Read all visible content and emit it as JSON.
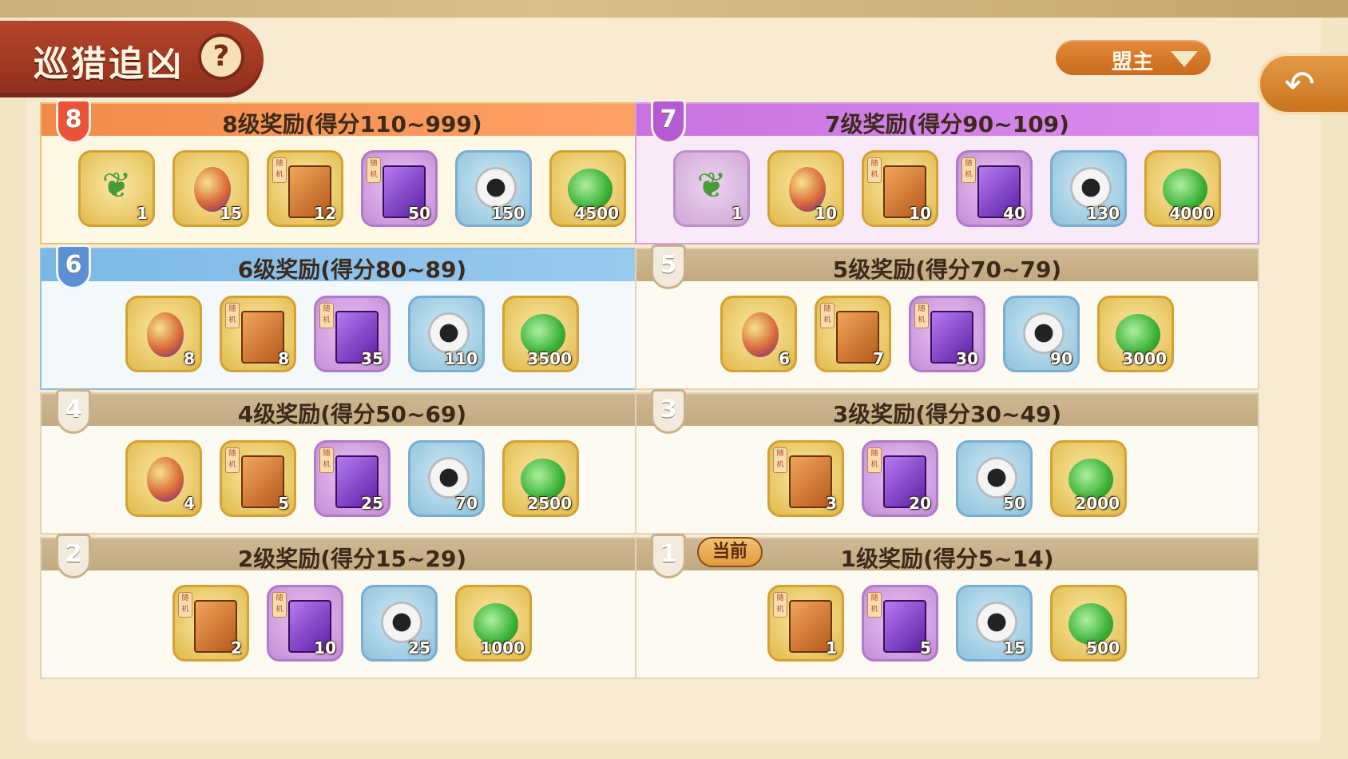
{
  "header": {
    "title": "巡猎追凶",
    "role_dropdown": "盟主"
  },
  "current_label": "当前",
  "panels": [
    {
      "tier": "8",
      "title": "8级奖励(得分110~999)",
      "items": [
        {
          "icon": "herb-icon",
          "qty": "1"
        },
        {
          "icon": "egg-icon",
          "qty": "15"
        },
        {
          "icon": "orange-box-icon",
          "qty": "12",
          "tag": "随机"
        },
        {
          "icon": "purple-box-icon",
          "qty": "50",
          "tag": "随机"
        },
        {
          "icon": "disc-icon",
          "qty": "150"
        },
        {
          "icon": "jade-icon",
          "qty": "4500"
        }
      ]
    },
    {
      "tier": "7",
      "title": "7级奖励(得分90~109)",
      "items": [
        {
          "icon": "herb-icon",
          "qty": "1"
        },
        {
          "icon": "egg-icon",
          "qty": "10"
        },
        {
          "icon": "orange-box-icon",
          "qty": "10",
          "tag": "随机"
        },
        {
          "icon": "purple-box-icon",
          "qty": "40",
          "tag": "随机"
        },
        {
          "icon": "disc-icon",
          "qty": "130"
        },
        {
          "icon": "jade-icon",
          "qty": "4000"
        }
      ]
    },
    {
      "tier": "6",
      "title": "6级奖励(得分80~89)",
      "items": [
        {
          "icon": "egg-icon",
          "qty": "8"
        },
        {
          "icon": "orange-box-icon",
          "qty": "8",
          "tag": "随机"
        },
        {
          "icon": "purple-box-icon",
          "qty": "35",
          "tag": "随机"
        },
        {
          "icon": "disc-icon",
          "qty": "110"
        },
        {
          "icon": "jade-icon",
          "qty": "3500"
        }
      ]
    },
    {
      "tier": "5",
      "title": "5级奖励(得分70~79)",
      "items": [
        {
          "icon": "egg-icon",
          "qty": "6"
        },
        {
          "icon": "orange-box-icon",
          "qty": "7",
          "tag": "随机"
        },
        {
          "icon": "purple-box-icon",
          "qty": "30",
          "tag": "随机"
        },
        {
          "icon": "disc-icon",
          "qty": "90"
        },
        {
          "icon": "jade-icon",
          "qty": "3000"
        }
      ]
    },
    {
      "tier": "4",
      "title": "4级奖励(得分50~69)",
      "items": [
        {
          "icon": "egg-icon",
          "qty": "4"
        },
        {
          "icon": "orange-box-icon",
          "qty": "5",
          "tag": "随机"
        },
        {
          "icon": "purple-box-icon",
          "qty": "25",
          "tag": "随机"
        },
        {
          "icon": "disc-icon",
          "qty": "70"
        },
        {
          "icon": "jade-icon",
          "qty": "2500"
        }
      ]
    },
    {
      "tier": "3",
      "title": "3级奖励(得分30~49)",
      "items": [
        {
          "icon": "orange-box-icon",
          "qty": "3",
          "tag": "随机"
        },
        {
          "icon": "purple-box-icon",
          "qty": "20",
          "tag": "随机"
        },
        {
          "icon": "disc-icon",
          "qty": "50"
        },
        {
          "icon": "jade-icon",
          "qty": "2000"
        }
      ]
    },
    {
      "tier": "2",
      "title": "2级奖励(得分15~29)",
      "items": [
        {
          "icon": "orange-box-icon",
          "qty": "2",
          "tag": "随机"
        },
        {
          "icon": "purple-box-icon",
          "qty": "10",
          "tag": "随机"
        },
        {
          "icon": "disc-icon",
          "qty": "25"
        },
        {
          "icon": "jade-icon",
          "qty": "1000"
        }
      ]
    },
    {
      "tier": "1",
      "title": "1级奖励(得分5~14)",
      "current": true,
      "items": [
        {
          "icon": "orange-box-icon",
          "qty": "1",
          "tag": "随机"
        },
        {
          "icon": "purple-box-icon",
          "qty": "5",
          "tag": "随机"
        },
        {
          "icon": "disc-icon",
          "qty": "15"
        },
        {
          "icon": "jade-icon",
          "qty": "500"
        }
      ]
    }
  ]
}
